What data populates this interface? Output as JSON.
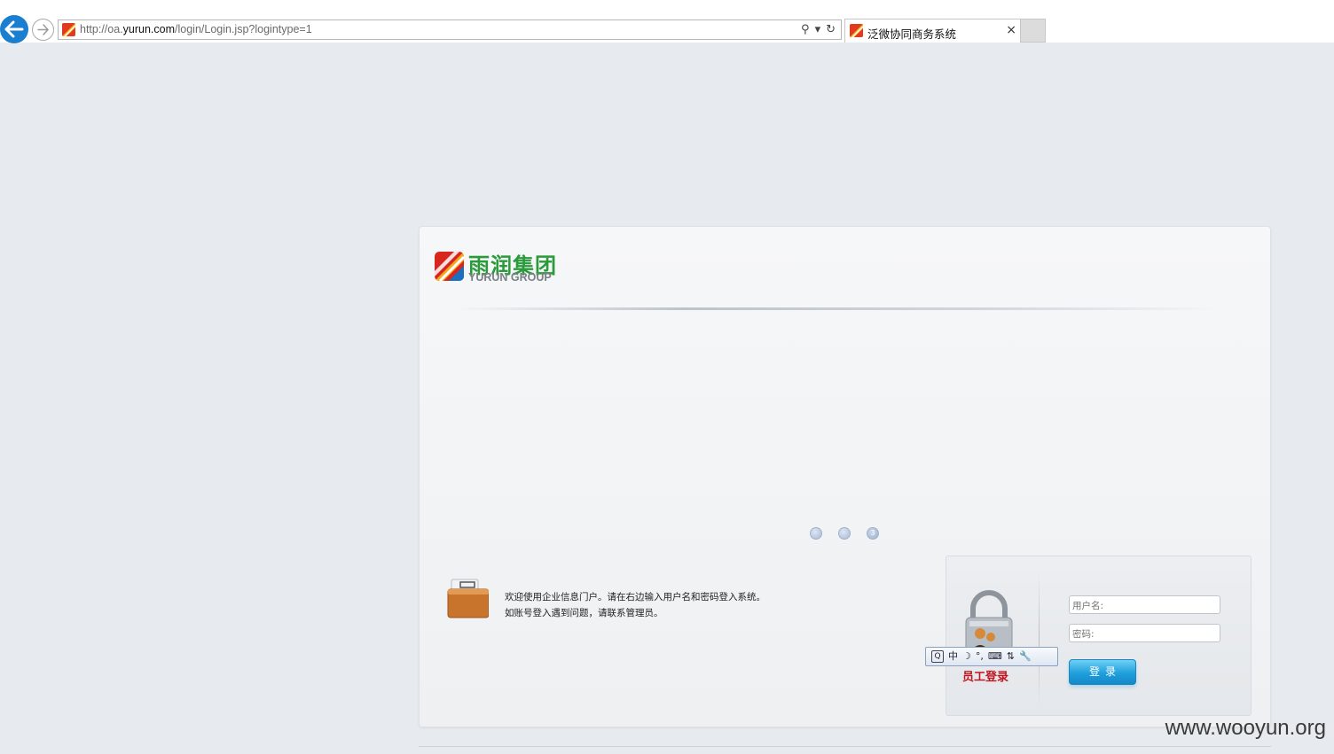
{
  "browser": {
    "url_prefix": "http://oa.",
    "url_host": "yurun.com",
    "url_path": "/login/Login.jsp?logintype=1",
    "search_icon": "⚲",
    "dropdown_icon": "▾",
    "refresh_icon": "↻",
    "tab_title": "泛微协同商务系统",
    "tab_close": "×"
  },
  "logo": {
    "cn": "雨润集团",
    "en": "YURUN GROUP"
  },
  "slider": {
    "dots": [
      "",
      "",
      "3"
    ]
  },
  "welcome": {
    "line1": "欢迎使用企业信息门户。请在右边输入用户名和密码登入系统。",
    "line2": "如账号登入遇到问题，请联系管理员。"
  },
  "login": {
    "employee_label": "员工登录",
    "username_placeholder": "用户名:",
    "password_placeholder": "密码:",
    "submit_label": "登录"
  },
  "ime": {
    "mode": "中",
    "moon": "☽",
    "punct": "°,",
    "keyboard": "⌨",
    "swap": "⇅",
    "tool": "🔧"
  },
  "watermark": "www.wooyun.org",
  "colors": {
    "brand_green": "#2a9a3a",
    "login_red": "#c0141e",
    "button_blue": "#1f9fdc",
    "browser_back": "#1a7fd0"
  }
}
